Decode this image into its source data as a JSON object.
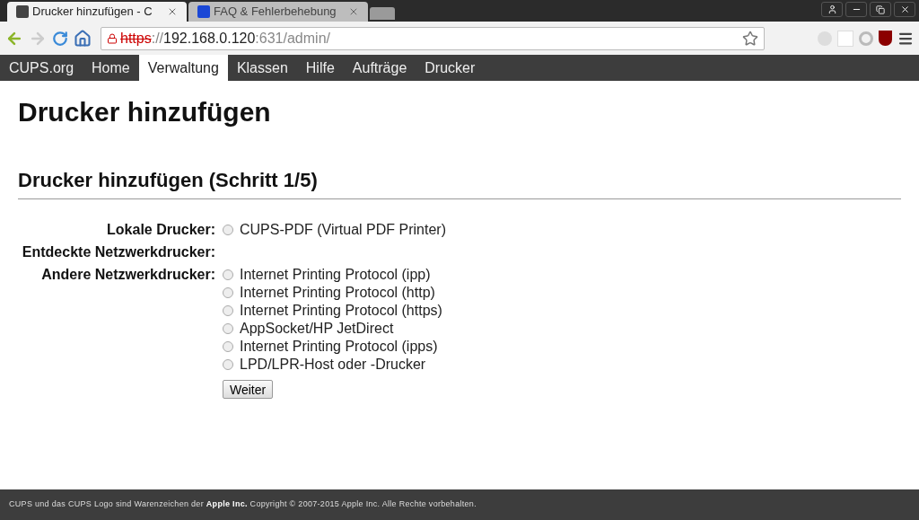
{
  "browser_tabs": [
    {
      "title": "Drucker hinzufügen - C",
      "color": "#444444",
      "selected": true
    },
    {
      "title": "FAQ & Fehlerbehebung",
      "color": "#1a47d6",
      "selected": false
    }
  ],
  "address_bar": {
    "scheme": "https",
    "separator": "://",
    "host": "192.168.0.120",
    "path": ":631/admin/"
  },
  "nav": [
    {
      "label": "CUPS.org",
      "selected": false
    },
    {
      "label": "Home",
      "selected": false
    },
    {
      "label": "Verwaltung",
      "selected": true
    },
    {
      "label": "Klassen",
      "selected": false
    },
    {
      "label": "Hilfe",
      "selected": false
    },
    {
      "label": "Aufträge",
      "selected": false
    },
    {
      "label": "Drucker",
      "selected": false
    }
  ],
  "page_title": "Drucker hinzufügen",
  "section_title": "Drucker hinzufügen (Schritt 1/5)",
  "groups": [
    {
      "label": "Lokale Drucker:",
      "options": [
        {
          "label": "CUPS-PDF (Virtual PDF Printer)",
          "selected": false
        }
      ]
    },
    {
      "label": "Entdeckte Netzwerkdrucker:"
    },
    {
      "label": "Andere Netzwerkdrucker:",
      "options": [
        {
          "label": "Internet Printing Protocol (ipp)",
          "selected": false
        },
        {
          "label": "Internet Printing Protocol (http)",
          "selected": false
        },
        {
          "label": "Internet Printing Protocol (https)",
          "selected": false
        },
        {
          "label": "AppSocket/HP JetDirect",
          "selected": false
        },
        {
          "label": "Internet Printing Protocol (ipps)",
          "selected": false
        },
        {
          "label": "LPD/LPR-Host oder -Drucker",
          "selected": false
        }
      ]
    }
  ],
  "continue_button": "Weiter",
  "footer": "CUPS und das CUPS Logo sind Warenzeichen der **Apple Inc.** Copyright © 2007-2015 Apple Inc. Alle Rechte vorbehalten."
}
